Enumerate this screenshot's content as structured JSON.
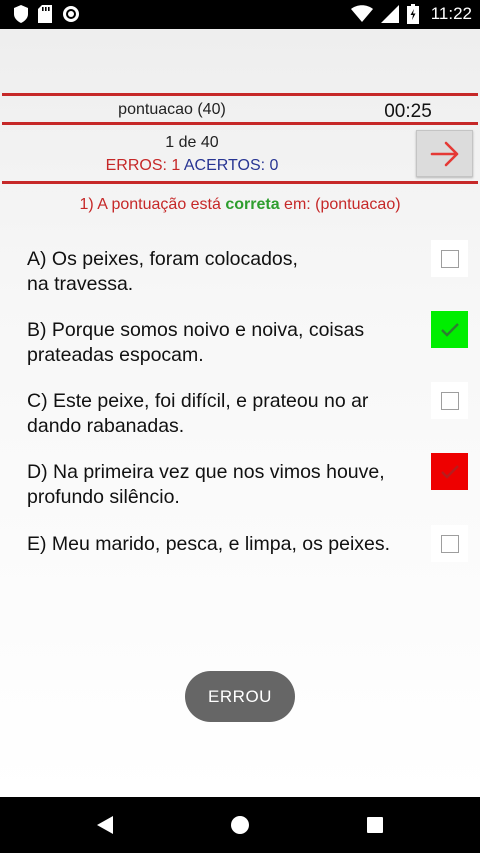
{
  "status_bar": {
    "time": "11:22",
    "left_icons": [
      "shield-icon",
      "sd-card-icon",
      "circle-dot-icon"
    ],
    "right_icons": [
      "wifi-icon",
      "signal-icon",
      "battery-icon"
    ]
  },
  "header": {
    "title": "pontuacao (40)",
    "timer": "00:25"
  },
  "progress": {
    "counter": "1 de 40",
    "errors_label": "ERROS: 1",
    "hits_label": "ACERTOS: 0"
  },
  "next_button": {
    "icon": "arrow-right-icon",
    "color": "#e53935"
  },
  "question": {
    "prefix": "1) A pontuação está ",
    "highlight": "correta",
    "suffix": " em: (pontuacao)"
  },
  "options": [
    {
      "line1": "A) Os peixes, foram colocados,",
      "line2": "na travessa.",
      "state": "unchecked"
    },
    {
      "line1": "B) Porque somos noivo e noiva, coisas",
      "line2": "prateadas espocam.",
      "state": "correct",
      "color": "#00ee00"
    },
    {
      "line1": "C) Este peixe, foi difícil, e prateou no ar",
      "line2": "dando rabanadas.",
      "state": "unchecked"
    },
    {
      "line1": "D) Na primeira vez que nos vimos houve,",
      "line2": "profundo silêncio.",
      "state": "wrong",
      "color": "#ee0000"
    },
    {
      "line1": "E) Meu marido, pesca, e limpa, os peixes.",
      "line2": "",
      "state": "unchecked"
    }
  ],
  "result_button": {
    "label": "ERROU"
  },
  "nav_bar": {
    "buttons": [
      "back-icon",
      "home-icon",
      "recents-icon"
    ]
  }
}
